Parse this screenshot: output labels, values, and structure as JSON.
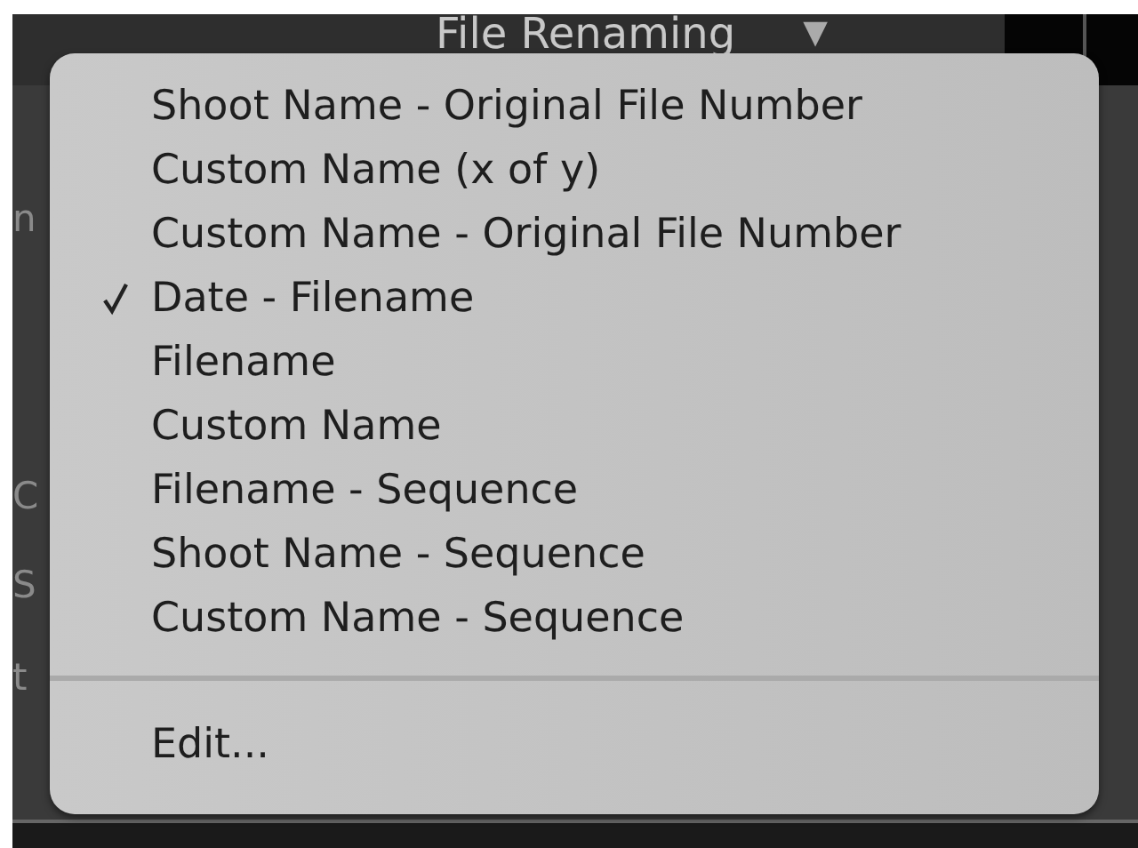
{
  "header": {
    "title": "File Renaming",
    "arrow": "▼"
  },
  "background_fragments": [
    "n",
    "C",
    "S",
    "t"
  ],
  "menu": {
    "items": [
      {
        "label": "Shoot Name - Original File Number",
        "selected": false
      },
      {
        "label": "Custom Name (x of y)",
        "selected": false
      },
      {
        "label": "Custom Name - Original File Number",
        "selected": false
      },
      {
        "label": "Date - Filename",
        "selected": true
      },
      {
        "label": "Filename",
        "selected": false
      },
      {
        "label": "Custom Name",
        "selected": false
      },
      {
        "label": "Filename - Sequence",
        "selected": false
      },
      {
        "label": "Shoot Name - Sequence",
        "selected": false
      },
      {
        "label": "Custom Name - Sequence",
        "selected": false
      }
    ],
    "footer_items": [
      {
        "label": "Edit..."
      }
    ]
  }
}
